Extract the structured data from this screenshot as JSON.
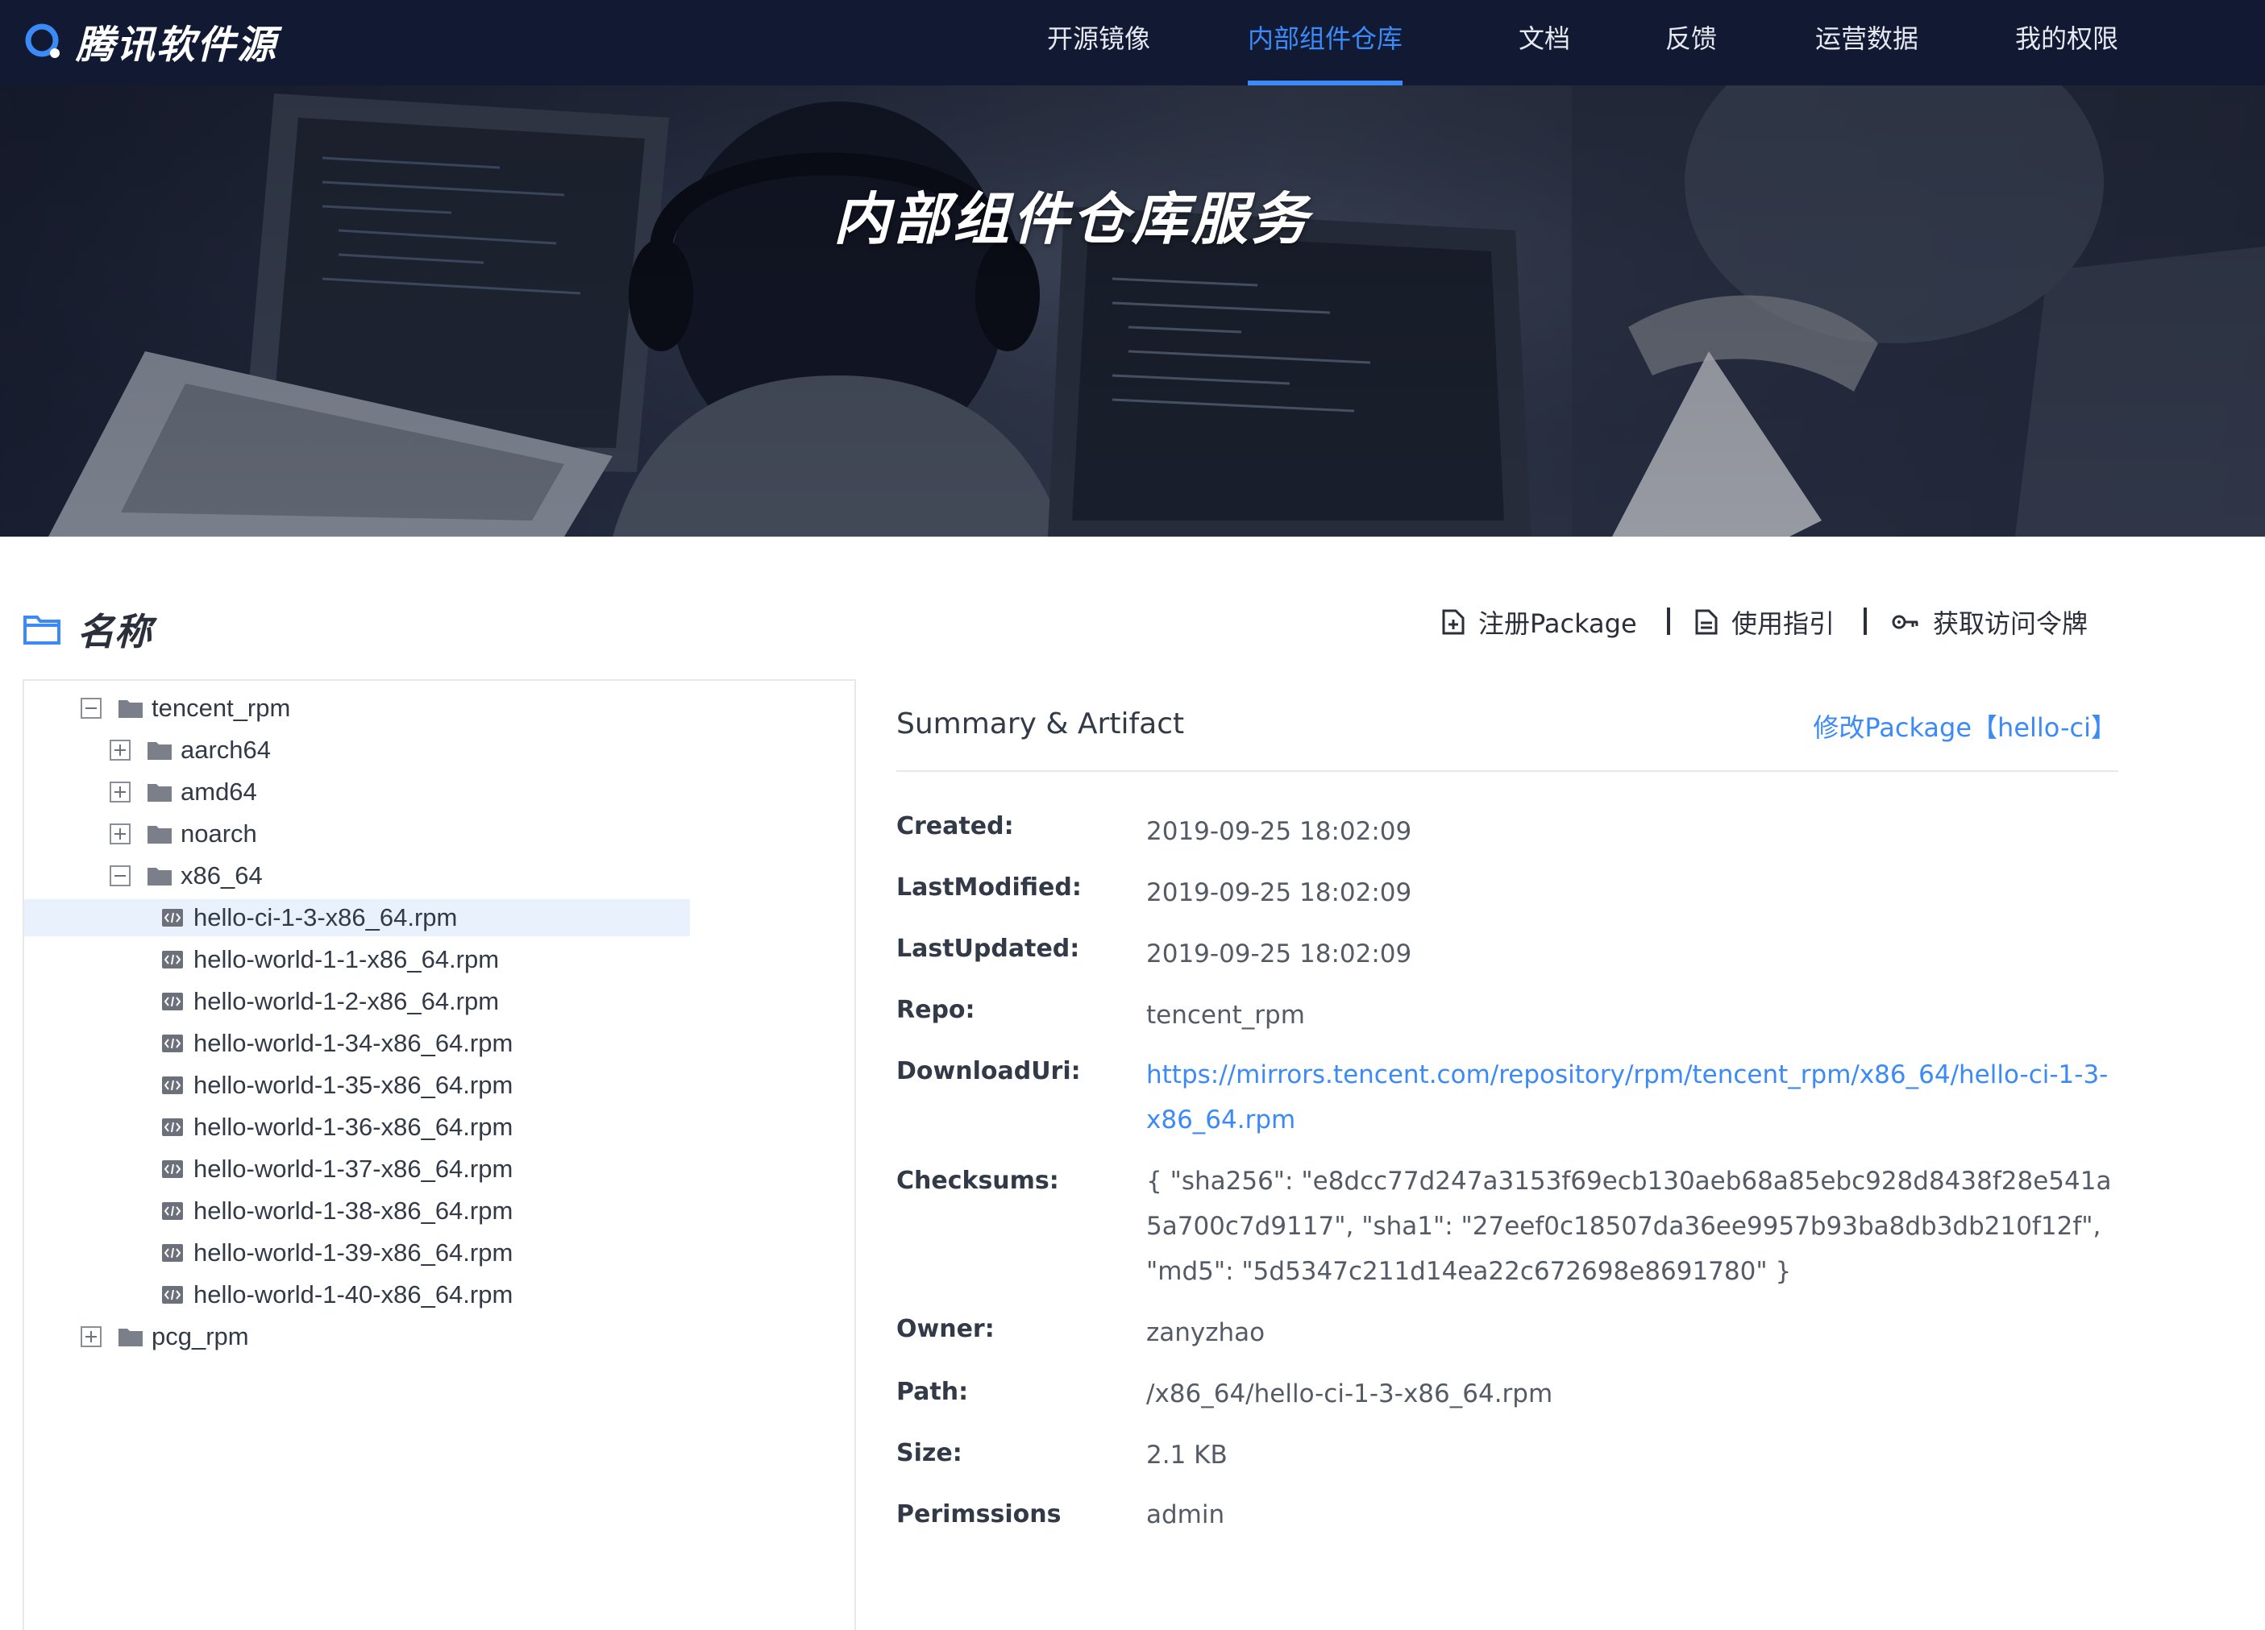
{
  "brand": {
    "name": "腾讯软件源",
    "logo_icon": "tencent-q-icon"
  },
  "nav": {
    "items": [
      {
        "label": "开源镜像"
      },
      {
        "label": "内部组件仓库",
        "active": true
      },
      {
        "label": "文档"
      },
      {
        "label": "反馈"
      },
      {
        "label": "运营数据"
      },
      {
        "label": "我的权限"
      }
    ]
  },
  "hero": {
    "title": "内部组件仓库服务"
  },
  "section": {
    "title": "名称",
    "icon": "folder-outline-icon"
  },
  "actions": [
    {
      "label": "注册Package",
      "icon": "file-add-icon"
    },
    {
      "label": "使用指引",
      "icon": "document-icon"
    },
    {
      "label": "获取访问令牌",
      "icon": "key-icon"
    }
  ],
  "tree": [
    {
      "label": "tencent_rpm",
      "type": "folder",
      "expanded": true,
      "level": 0
    },
    {
      "label": "aarch64",
      "type": "folder",
      "expanded": false,
      "level": 1
    },
    {
      "label": "amd64",
      "type": "folder",
      "expanded": false,
      "level": 1
    },
    {
      "label": "noarch",
      "type": "folder",
      "expanded": false,
      "level": 1
    },
    {
      "label": "x86_64",
      "type": "folder",
      "expanded": true,
      "level": 1
    },
    {
      "label": "hello-ci-1-3-x86_64.rpm",
      "type": "file",
      "level": 2,
      "selected": true
    },
    {
      "label": "hello-world-1-1-x86_64.rpm",
      "type": "file",
      "level": 2
    },
    {
      "label": "hello-world-1-2-x86_64.rpm",
      "type": "file",
      "level": 2
    },
    {
      "label": "hello-world-1-34-x86_64.rpm",
      "type": "file",
      "level": 2
    },
    {
      "label": "hello-world-1-35-x86_64.rpm",
      "type": "file",
      "level": 2
    },
    {
      "label": "hello-world-1-36-x86_64.rpm",
      "type": "file",
      "level": 2
    },
    {
      "label": "hello-world-1-37-x86_64.rpm",
      "type": "file",
      "level": 2
    },
    {
      "label": "hello-world-1-38-x86_64.rpm",
      "type": "file",
      "level": 2
    },
    {
      "label": "hello-world-1-39-x86_64.rpm",
      "type": "file",
      "level": 2
    },
    {
      "label": "hello-world-1-40-x86_64.rpm",
      "type": "file",
      "level": 2
    },
    {
      "label": "pcg_rpm",
      "type": "folder",
      "expanded": false,
      "level": 0
    }
  ],
  "detail": {
    "title": "Summary & Artifact",
    "edit_link": "修改Package【hello-ci】",
    "props": [
      {
        "label": "Created:",
        "value": "2019-09-25 18:02:09"
      },
      {
        "label": "LastModified:",
        "value": "2019-09-25 18:02:09"
      },
      {
        "label": "LastUpdated:",
        "value": "2019-09-25 18:02:09"
      },
      {
        "label": "Repo:",
        "value": "tencent_rpm"
      },
      {
        "label": "DownloadUri:",
        "value": "https://mirrors.tencent.com/repository/rpm/tencent_rpm/x86_64/hello-ci-1-3-x86_64.rpm",
        "link": true
      },
      {
        "label": "Checksums:",
        "value": "{ \"sha256\": \"e8dcc77d247a3153f69ecb130aeb68a85ebc928d8438f28e541a5a700c7d9117\", \"sha1\": \"27eef0c18507da36ee9957b93ba8db3db210f12f\", \"md5\": \"5d5347c211d14ea22c672698e8691780\" }"
      },
      {
        "label": "Owner:",
        "value": "zanyzhao"
      },
      {
        "label": "Path:",
        "value": "/x86_64/hello-ci-1-3-x86_64.rpm"
      },
      {
        "label": "Size:",
        "value": "2.1 KB"
      },
      {
        "label": "Perimssions",
        "value": "admin"
      }
    ]
  },
  "colors": {
    "nav_bg": "#121a33",
    "accent": "#3b8af7",
    "selected_row_bg": "#e9f1fc",
    "text": "#333a47",
    "muted_text": "#555b66"
  }
}
